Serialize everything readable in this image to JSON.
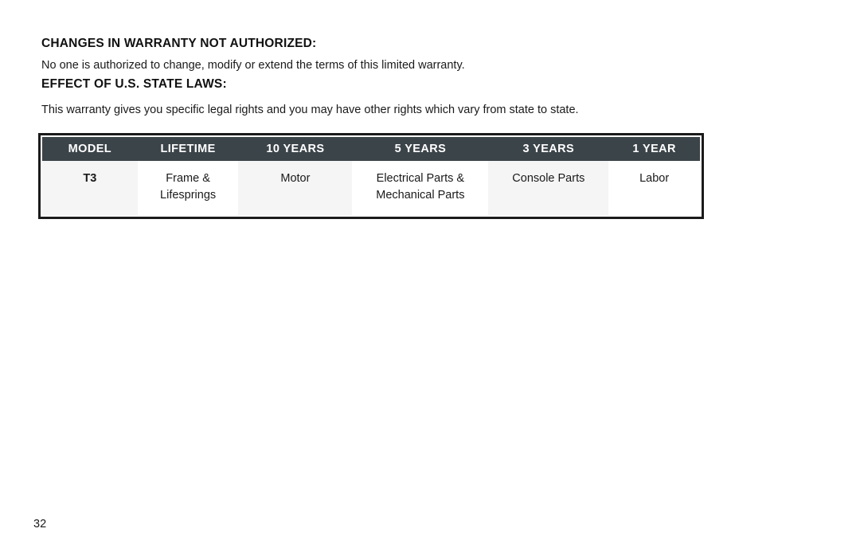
{
  "document": {
    "page_number": "32"
  },
  "sections": [
    {
      "heading": "CHANGES IN WARRANTY NOT AUTHORIZED:",
      "paragraph": "No one is authorized to change, modify or extend the terms of this limited warranty."
    },
    {
      "heading": "EFFECT OF U.S. STATE LAWS:",
      "paragraph": "This warranty gives you specific legal rights and you may have other rights which vary from state to state."
    }
  ],
  "warranty_table": {
    "colors": {
      "header_background": "#3b4449",
      "header_text": "#ffffff",
      "border": "#1b1b1b",
      "shaded_cell": "#f5f5f5",
      "plain_cell": "#ffffff"
    },
    "headers": [
      "MODEL",
      "LIFETIME",
      "10 YEARS",
      "5 YEARS",
      "3 YEARS",
      "1 YEAR"
    ],
    "rows": [
      {
        "model": "T3",
        "lifetime_line1": "Frame &",
        "lifetime_line2": "Lifesprings",
        "ten_years": "Motor",
        "five_years_line1": "Electrical Parts &",
        "five_years_line2": "Mechanical Parts",
        "three_years": "Console Parts",
        "one_year": "Labor"
      }
    ]
  }
}
